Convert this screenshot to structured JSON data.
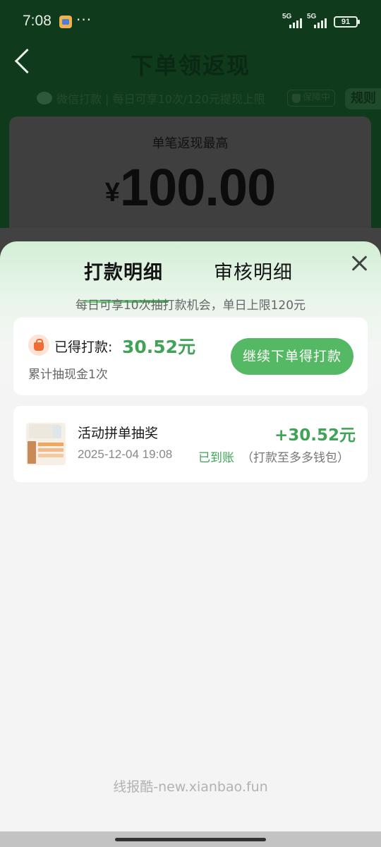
{
  "status_bar": {
    "time": "7:08",
    "dots": "···",
    "signal_1": "5G",
    "signal_2": "5G",
    "battery": "91"
  },
  "background_page": {
    "title": "下单领返现",
    "subline": "微信打款 | 每日可享10次/120元提现上限",
    "guarantee_badge": "保障中",
    "rules_button": "规则",
    "card_label": "单笔返现最高",
    "card_currency": "¥",
    "card_amount": "100.00"
  },
  "sheet": {
    "tabs": [
      {
        "label": "打款明细",
        "active": true
      },
      {
        "label": "审核明细",
        "active": false
      }
    ],
    "note": "每日可享10次抽打款机会，单日上限120元",
    "summary": {
      "earned_label": "已得打款:",
      "earned_amount": "30.52元",
      "cumulative": "累计抽现金1次",
      "continue_button": "继续下单得打款"
    },
    "records": [
      {
        "title": "活动拼单抽奖",
        "time": "2025-12-04 19:08",
        "amount": "+30.52元",
        "status": "已到账",
        "status_note": "（打款至多多钱包）"
      }
    ]
  },
  "watermark": "线报酷-new.xianbao.fun",
  "colors": {
    "accent_green": "#41a357",
    "button_green": "#55b864",
    "dark_backdrop": "#0f3a1c"
  }
}
